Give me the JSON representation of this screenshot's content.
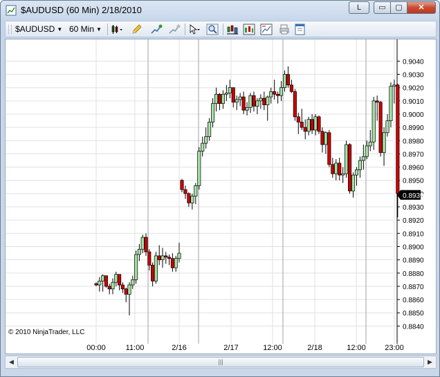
{
  "window": {
    "title": "$AUDUSD (60 Min)  2/18/2010",
    "lock_button": "L",
    "minimize_glyph": "▭",
    "maximize_glyph": "▢",
    "close_glyph": "✕"
  },
  "toolbar": {
    "instrument": "$AUDUSD",
    "interval": "60 Min",
    "icons": [
      "bar-type-icon",
      "drawing-pencil-icon",
      "indicator-add-icon",
      "strategy-icon",
      "cursor-select-icon",
      "zoom-icon",
      "data-box-icon",
      "chart-trader-icon",
      "properties-icon",
      "print-icon",
      "window-layout-icon"
    ]
  },
  "chart": {
    "copyright": "© 2010 NinjaTrader, LLC",
    "last_price_label": "0.8939",
    "colors": {
      "up": "#a4e0a4",
      "down": "#cc0000",
      "wick": "#000000",
      "grid": "#e0e0e0",
      "session_line": "#a0a0a0"
    }
  },
  "scroll": {
    "thumb_glyph": "|||"
  },
  "chart_data": {
    "type": "candlestick",
    "yticks": [
      "0.8840",
      "0.8850",
      "0.8860",
      "0.8870",
      "0.8880",
      "0.8890",
      "0.8900",
      "0.8910",
      "0.8920",
      "0.8930",
      "0.8940",
      "0.8950",
      "0.8960",
      "0.8970",
      "0.8980",
      "0.8990",
      "0.9000",
      "0.9010",
      "0.9020",
      "0.9030",
      "0.9040"
    ],
    "ylim": [
      0.8836,
      0.9047
    ],
    "xticks": [
      "00:00",
      "11:00",
      "2/16",
      "2/17",
      "12:00",
      "2/18",
      "12:00",
      "23:00"
    ],
    "last_price": 0.8939,
    "candles": [
      [
        0.8872,
        0.8873,
        0.887,
        0.8871
      ],
      [
        0.8871,
        0.8877,
        0.8866,
        0.8874
      ],
      [
        0.8874,
        0.8879,
        0.8866,
        0.8878
      ],
      [
        0.8878,
        0.8878,
        0.8869,
        0.887
      ],
      [
        0.887,
        0.8872,
        0.8864,
        0.8868
      ],
      [
        0.8868,
        0.8876,
        0.8864,
        0.8873
      ],
      [
        0.8873,
        0.8881,
        0.887,
        0.8879
      ],
      [
        0.8879,
        0.8879,
        0.8867,
        0.8871
      ],
      [
        0.8871,
        0.8873,
        0.8865,
        0.8868
      ],
      [
        0.8868,
        0.8869,
        0.8858,
        0.8864
      ],
      [
        0.8864,
        0.8873,
        0.8848,
        0.8871
      ],
      [
        0.8871,
        0.8878,
        0.8868,
        0.8875
      ],
      [
        0.8875,
        0.8897,
        0.8872,
        0.8894
      ],
      [
        0.8894,
        0.8902,
        0.8889,
        0.8898
      ],
      [
        0.8898,
        0.8909,
        0.8895,
        0.8907
      ],
      [
        0.8907,
        0.891,
        0.8893,
        0.8896
      ],
      [
        0.8896,
        0.8898,
        0.8882,
        0.8886
      ],
      [
        0.8886,
        0.8888,
        0.887,
        0.8874
      ],
      [
        0.8874,
        0.8896,
        0.8872,
        0.8893
      ],
      [
        0.8893,
        0.8901,
        0.8886,
        0.889
      ],
      [
        0.889,
        0.8899,
        0.8884,
        0.8893
      ],
      [
        0.8893,
        0.8896,
        0.8887,
        0.8892
      ],
      [
        0.8892,
        0.8894,
        0.8886,
        0.8891
      ],
      [
        0.8891,
        0.8895,
        0.8881,
        0.8884
      ],
      [
        0.8884,
        0.8893,
        0.8881,
        0.8891
      ],
      [
        0.8891,
        0.8903,
        0.8888,
        0.8895
      ],
      [
        0.895,
        0.8951,
        0.8941,
        0.8943
      ],
      [
        0.8943,
        0.8946,
        0.8936,
        0.894
      ],
      [
        0.894,
        0.8941,
        0.893,
        0.8933
      ],
      [
        0.8933,
        0.894,
        0.8928,
        0.8938
      ],
      [
        0.8938,
        0.8948,
        0.8932,
        0.8946
      ],
      [
        0.8946,
        0.8975,
        0.8943,
        0.8972
      ],
      [
        0.8972,
        0.8983,
        0.8968,
        0.8978
      ],
      [
        0.8978,
        0.899,
        0.8974,
        0.8983
      ],
      [
        0.8983,
        0.8997,
        0.898,
        0.8994
      ],
      [
        0.8994,
        0.9012,
        0.899,
        0.9008
      ],
      [
        0.9008,
        0.902,
        0.9002,
        0.9015
      ],
      [
        0.9015,
        0.9016,
        0.9003,
        0.9008
      ],
      [
        0.9008,
        0.9018,
        0.9004,
        0.9015
      ],
      [
        0.9015,
        0.9022,
        0.901,
        0.9016
      ],
      [
        0.9016,
        0.9026,
        0.9012,
        0.902
      ],
      [
        0.902,
        0.902,
        0.9005,
        0.9009
      ],
      [
        0.9009,
        0.9014,
        0.9003,
        0.9011
      ],
      [
        0.9011,
        0.9016,
        0.9006,
        0.9013
      ],
      [
        0.9013,
        0.9017,
        0.9,
        0.9003
      ],
      [
        0.9003,
        0.9009,
        0.8999,
        0.9005
      ],
      [
        0.9005,
        0.9016,
        0.9001,
        0.9014
      ],
      [
        0.9014,
        0.9017,
        0.9002,
        0.9006
      ],
      [
        0.9006,
        0.9012,
        0.9,
        0.901
      ],
      [
        0.901,
        0.9015,
        0.9004,
        0.9012
      ],
      [
        0.9012,
        0.9017,
        0.9003,
        0.9007
      ],
      [
        0.9007,
        0.9014,
        0.8995,
        0.9013
      ],
      [
        0.9013,
        0.902,
        0.9008,
        0.9017
      ],
      [
        0.9017,
        0.9026,
        0.9011,
        0.9015
      ],
      [
        0.9015,
        0.9017,
        0.9008,
        0.9014
      ],
      [
        0.9014,
        0.9025,
        0.901,
        0.902
      ],
      [
        0.902,
        0.9033,
        0.9017,
        0.903
      ],
      [
        0.903,
        0.9036,
        0.902,
        0.9022
      ],
      [
        0.9022,
        0.9026,
        0.9016,
        0.9017
      ],
      [
        0.9017,
        0.9019,
        0.8995,
        0.8998
      ],
      [
        0.8998,
        0.9001,
        0.8985,
        0.8994
      ],
      [
        0.8994,
        0.9004,
        0.8988,
        0.899
      ],
      [
        0.899,
        0.8996,
        0.8981,
        0.8987
      ],
      [
        0.8987,
        0.8998,
        0.8984,
        0.8996
      ],
      [
        0.8996,
        0.9,
        0.8985,
        0.8988
      ],
      [
        0.8988,
        0.9,
        0.8984,
        0.8998
      ],
      [
        0.8998,
        0.8999,
        0.8985,
        0.8987
      ],
      [
        0.8987,
        0.899,
        0.8971,
        0.8977
      ],
      [
        0.8977,
        0.8987,
        0.897,
        0.8986
      ],
      [
        0.8986,
        0.8988,
        0.896,
        0.8962
      ],
      [
        0.8962,
        0.8967,
        0.8952,
        0.8955
      ],
      [
        0.8955,
        0.8966,
        0.895,
        0.8963
      ],
      [
        0.8963,
        0.8967,
        0.895,
        0.8954
      ],
      [
        0.8954,
        0.896,
        0.8948,
        0.8955
      ],
      [
        0.8955,
        0.898,
        0.8952,
        0.8977
      ],
      [
        0.8977,
        0.8978,
        0.894,
        0.8942
      ],
      [
        0.8942,
        0.8956,
        0.8937,
        0.8954
      ],
      [
        0.8954,
        0.896,
        0.8946,
        0.8958
      ],
      [
        0.8958,
        0.8968,
        0.8952,
        0.8965
      ],
      [
        0.8965,
        0.8977,
        0.8958,
        0.8968
      ],
      [
        0.8968,
        0.898,
        0.8966,
        0.8976
      ],
      [
        0.8976,
        0.8988,
        0.8972,
        0.8979
      ],
      [
        0.8979,
        0.9013,
        0.8973,
        0.901
      ],
      [
        0.901,
        0.9014,
        0.8995,
        0.9009
      ],
      [
        0.9009,
        0.901,
        0.8968,
        0.8971
      ],
      [
        0.8971,
        0.899,
        0.8961,
        0.8986
      ],
      [
        0.8986,
        0.9,
        0.8983,
        0.8995
      ],
      [
        0.8995,
        0.9024,
        0.899,
        0.9021
      ],
      [
        0.9021,
        0.9026,
        0.9008,
        0.9022
      ],
      [
        0.9022,
        0.9023,
        0.8922,
        0.894
      ]
    ]
  }
}
